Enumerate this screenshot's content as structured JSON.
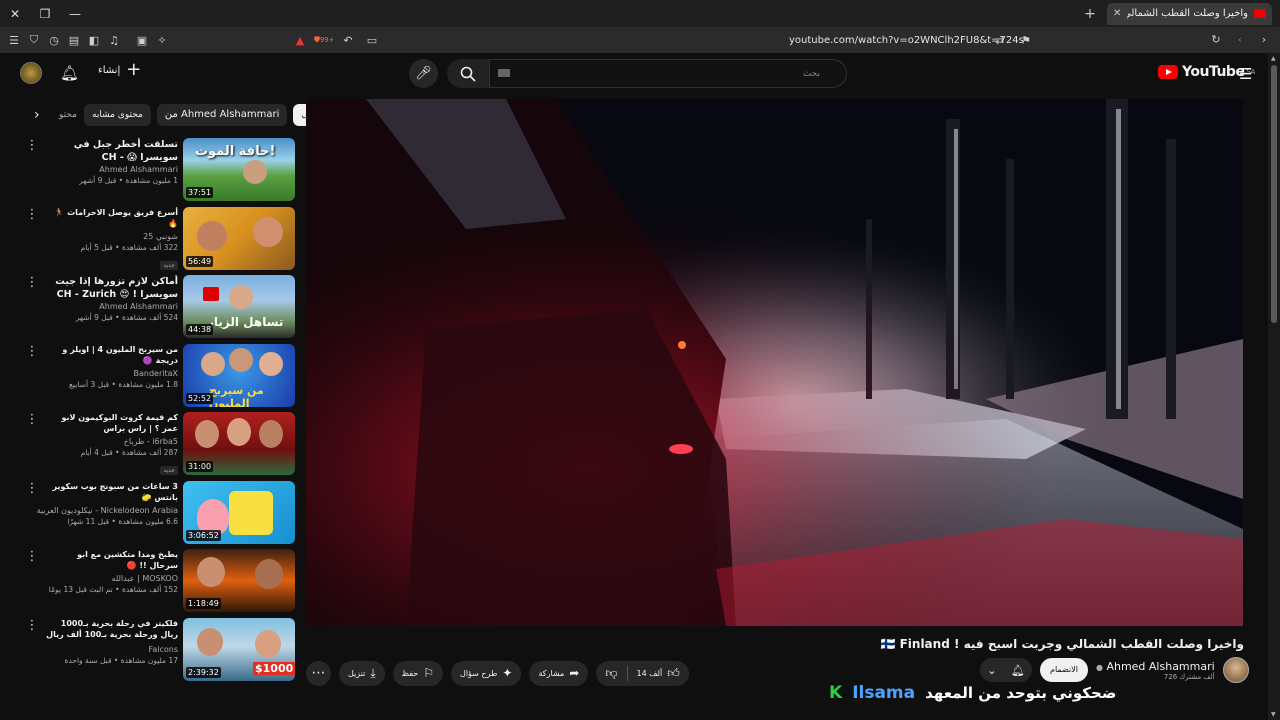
{
  "tab": {
    "title": "واخيرا وصلت القطب الشمالي وجر"
  },
  "toolbar": {
    "url": "youtube.com/watch?v=o2WNClh2FU8&t=724s",
    "badge": "99+"
  },
  "header": {
    "create": "إنشاء",
    "search_placeholder": "بحث",
    "logo": "YouTube",
    "region": "SA"
  },
  "chips": [
    "الكل",
    "من Ahmed Alshammari",
    "محتوى مشابه",
    "محتو"
  ],
  "sidebar": {
    "items": [
      {
        "title": "تسلقت أخطر جبل في سويسرا 😱 - CH Switzerland Mountains",
        "channel": "Ahmed Alshammari",
        "stats": "1 مليون مشاهدة • قبل 9 أشهر",
        "duration": "37:51",
        "badge": ""
      },
      {
        "title": "أسرع فريق يوصل الاحرامات 🏃 🔥",
        "channel": "شونبي 25",
        "stats": "322 ألف مشاهدة • قبل 5 أيام",
        "duration": "56:49",
        "badge": "جديد"
      },
      {
        "title": "أماكن لازم تزورها إذا جيت سويسرا ! 😍 CH - Zurich and Davos",
        "channel": "Ahmed Alshammari",
        "stats": "524 ألف مشاهدة • قبل 9 أشهر",
        "duration": "44:38",
        "badge": ""
      },
      {
        "title": "من سيربح المليون 4 | اويلر و دريجة 🟣",
        "channel": "BanderitaX",
        "stats": "1.8 مليون مشاهدة • قبل 3 أسابيع",
        "duration": "52:52",
        "badge": ""
      },
      {
        "title": "كم قيمة كروت البوكيمون لابو عمر ؟ | راس براس",
        "channel": "i6rba5 - طرباخ",
        "stats": "287 ألف مشاهدة • قبل 4 أيام",
        "duration": "31:00",
        "badge": "جديد"
      },
      {
        "title": "3 ساعات من سبونج بوب سكوير بانتس 🧽",
        "channel": "Nickelodeon Arabia - نيكلوديون العربية",
        "stats": "6.6 مليون مشاهدة • قبل 11 شهرًا",
        "duration": "3:06:52",
        "badge": ""
      },
      {
        "title": "يطبخ ومدا متكشين مع ابو سرحال !! 🔴",
        "channel": "MOSKOO | عبدالله",
        "stats": "152 ألف مشاهدة • تم البث قبل 13 يومًا",
        "duration": "1:18:49",
        "badge": ""
      },
      {
        "title": "فلكيتر في رحلة بحرية بـ1000 ريال ورحلة بحرية بـ100 ألف ريال 🛥️",
        "channel": "Falcons",
        "stats": "17 مليون مشاهدة • قبل سنة واحدة",
        "duration": "2:39:32",
        "badge": ""
      }
    ]
  },
  "video": {
    "title": "واخيرا وصلت القطب الشمالي وجربت اسبح فيه ! 🇫🇮 Finland"
  },
  "actions": {
    "likes": "14 ألف",
    "share": "مشاركة",
    "ask": "طرح سؤال",
    "save": "حفظ",
    "download": "تنزيل"
  },
  "channel": {
    "name": "Ahmed Alshammari",
    "subs": "726 ألف مشترك",
    "join": "الانضمام"
  },
  "caption": {
    "k": "K",
    "brand": "Ilsama",
    "text": "ضحكوني بتوحد من المعهد"
  }
}
